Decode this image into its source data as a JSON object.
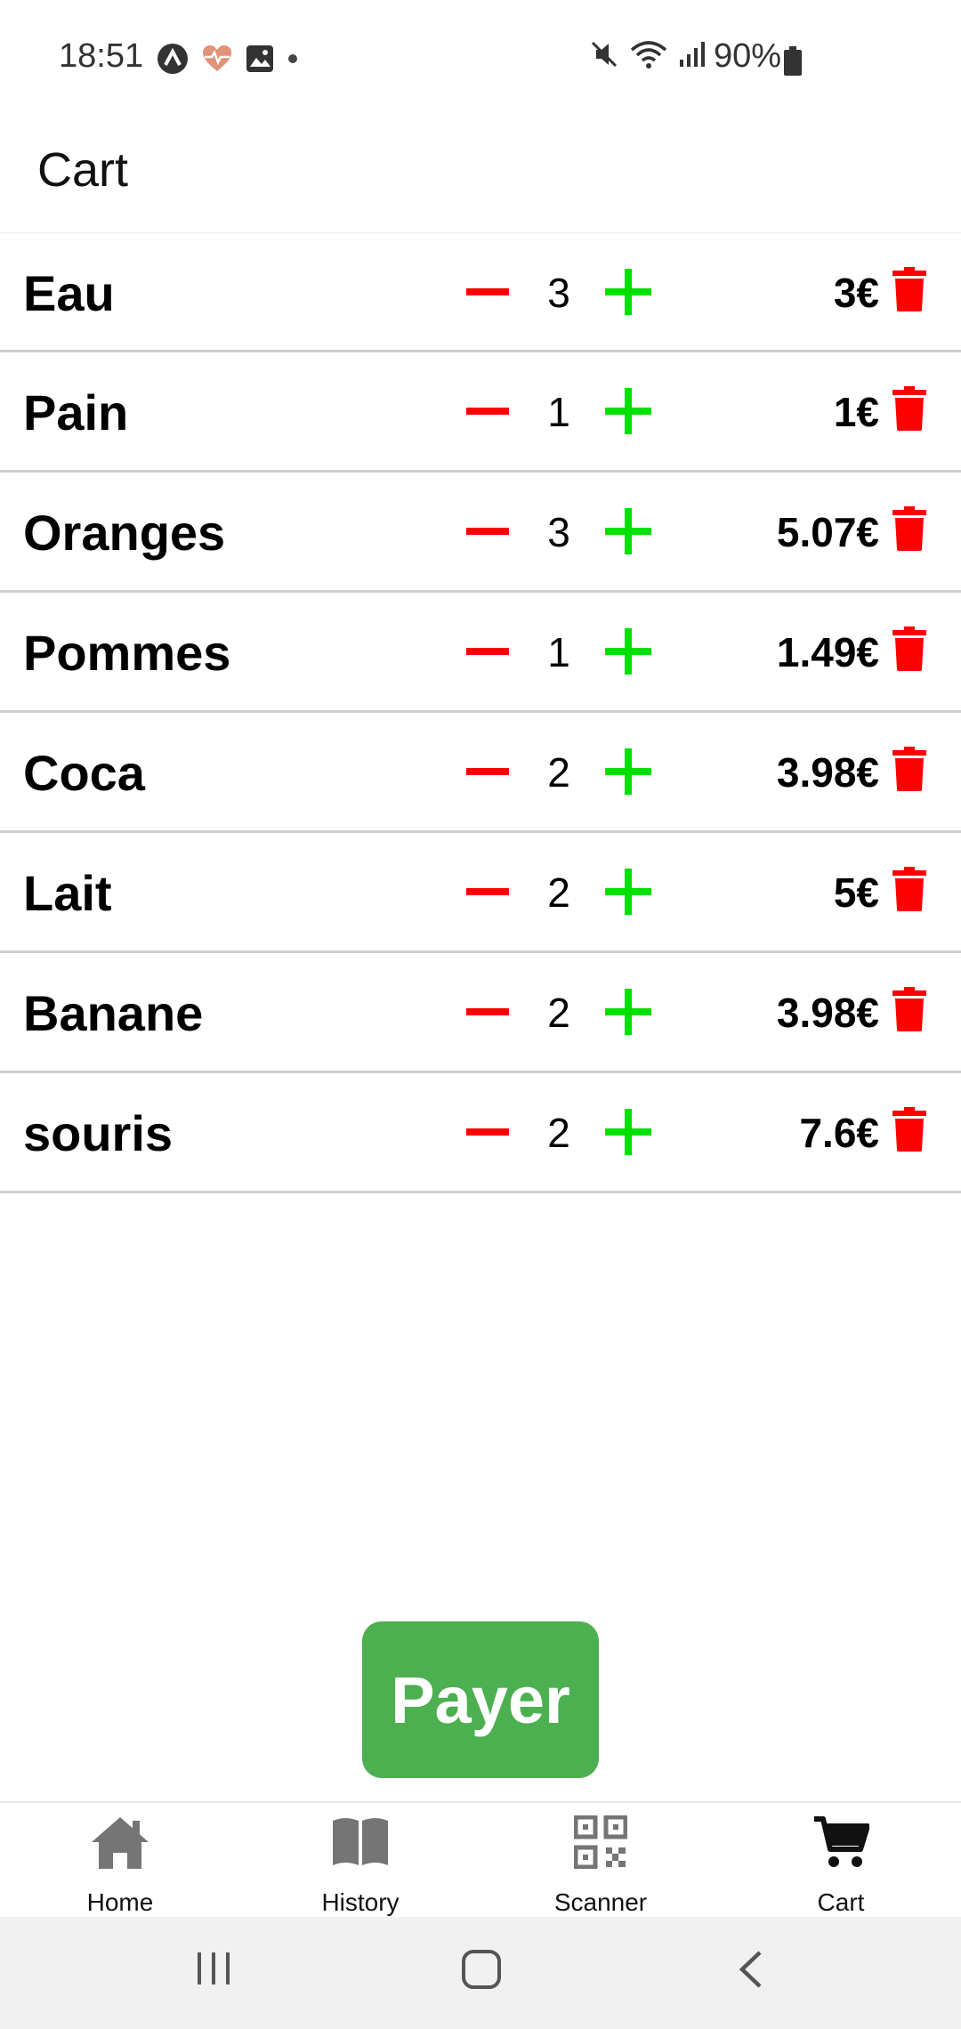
{
  "status_bar": {
    "time": "18:51",
    "battery_pct": "90%",
    "left_icons": [
      "app-a-icon",
      "heart-pulse-icon",
      "image-icon",
      "dot-icon"
    ],
    "right_icons": [
      "mute-icon",
      "wifi-icon",
      "signal-icon",
      "battery-icon"
    ]
  },
  "header": {
    "title": "Cart"
  },
  "cart": {
    "items": [
      {
        "name": "Eau",
        "qty": "3",
        "price": "3€"
      },
      {
        "name": "Pain",
        "qty": "1",
        "price": "1€"
      },
      {
        "name": "Oranges",
        "qty": "3",
        "price": "5.07€"
      },
      {
        "name": "Pommes",
        "qty": "1",
        "price": "1.49€"
      },
      {
        "name": "Coca",
        "qty": "2",
        "price": "3.98€"
      },
      {
        "name": "Lait",
        "qty": "2",
        "price": "5€"
      },
      {
        "name": "Banane",
        "qty": "2",
        "price": "3.98€"
      },
      {
        "name": "souris",
        "qty": "2",
        "price": "7.6€"
      }
    ]
  },
  "pay_button": {
    "label": "Payer"
  },
  "bottom_nav": {
    "items": [
      {
        "label": "Home",
        "icon": "home-icon"
      },
      {
        "label": "History",
        "icon": "book-icon"
      },
      {
        "label": "Scanner",
        "icon": "qr-code-icon"
      },
      {
        "label": "Cart",
        "icon": "cart-icon",
        "active": true
      }
    ]
  },
  "system_nav": {
    "icons": [
      "recent-apps-icon",
      "home-button-icon",
      "back-icon"
    ]
  },
  "colors": {
    "minus": "#ff0000",
    "plus": "#00e000",
    "trash": "#ff0000",
    "pay_button": "#4caf50",
    "nav_icon_inactive": "#757575",
    "nav_icon_active": "#111111"
  }
}
